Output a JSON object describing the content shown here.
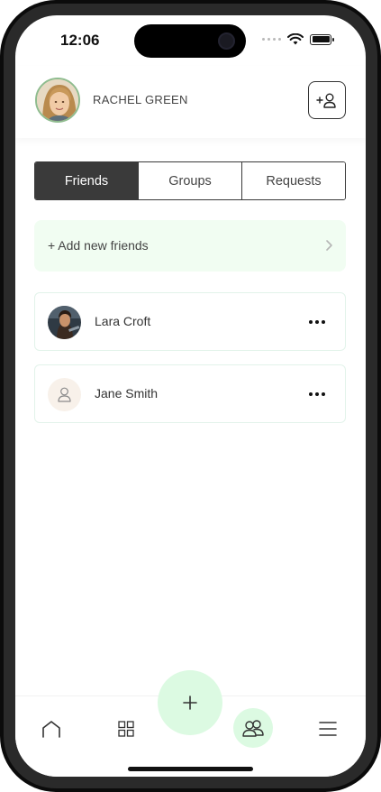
{
  "status_bar": {
    "time": "12:06"
  },
  "header": {
    "user_name": "RACHEL GREEN",
    "add_friend_icon": "add-user-icon"
  },
  "tabs": [
    {
      "label": "Friends",
      "active": true
    },
    {
      "label": "Groups",
      "active": false
    },
    {
      "label": "Requests",
      "active": false
    }
  ],
  "add_new": {
    "label": "+ Add new friends"
  },
  "friends": [
    {
      "name": "Lara Croft",
      "avatar": "photo"
    },
    {
      "name": "Jane Smith",
      "avatar": "placeholder-person-icon"
    }
  ],
  "bottom_nav": {
    "items": [
      "home-icon",
      "grid-icon",
      "plus-icon",
      "friends-icon",
      "menu-icon"
    ],
    "active": "friends-icon"
  },
  "colors": {
    "accent_light_green": "#dcfae2",
    "add_new_bg": "#f1fdf2",
    "tab_active_bg": "#3a3a3a"
  }
}
